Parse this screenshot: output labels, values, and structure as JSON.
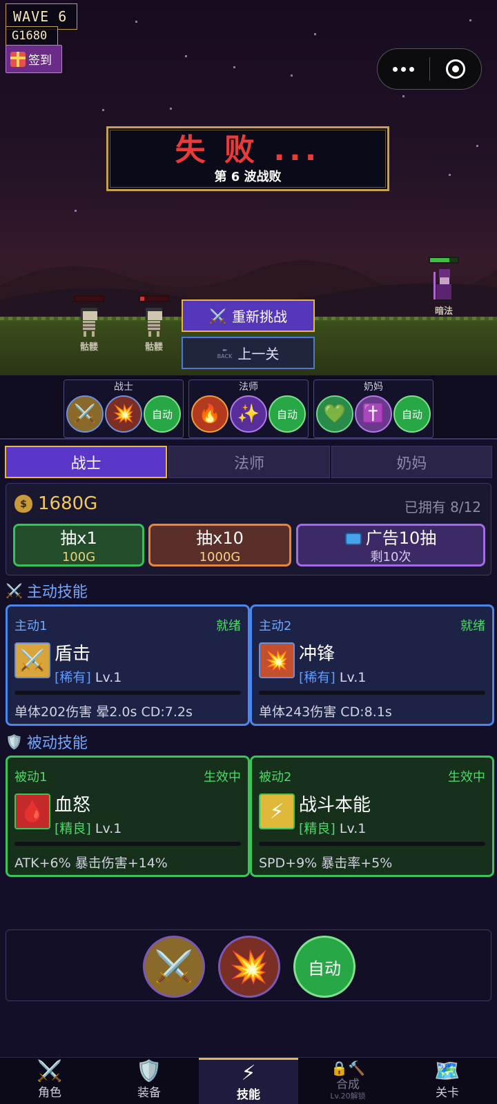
{
  "hud": {
    "wave": "WAVE  6",
    "gold": "G1680",
    "signin": "签到"
  },
  "result": {
    "title": "失 败 ...",
    "subtitle": "第 6 波战败",
    "retry": "重新挑战",
    "prev": "上一关",
    "prev_icon_text": "BACK"
  },
  "enemies": [
    {
      "name": "骷髅",
      "hp": 0.0
    },
    {
      "name": "骷髅",
      "hp": 0.15
    }
  ],
  "ally": {
    "name": "暗法",
    "hp": 0.7
  },
  "heroes": [
    {
      "name": "战士",
      "skills": [
        "swords-icon",
        "explosion-icon"
      ],
      "auto": "自动"
    },
    {
      "name": "法师",
      "skills": [
        "fire-icon",
        "sparkles-icon"
      ],
      "auto": "自动"
    },
    {
      "name": "奶妈",
      "skills": [
        "heart-icon",
        "cross-icon"
      ],
      "auto": "自动"
    }
  ],
  "tabs": [
    "战士",
    "法师",
    "奶妈"
  ],
  "gacha": {
    "gold": "1680G",
    "owned": "已拥有 8/12",
    "draw1": {
      "label": "抽x1",
      "cost": "100G"
    },
    "draw10": {
      "label": "抽x10",
      "cost": "1000G"
    },
    "ad": {
      "label": "广告10抽",
      "remain": "剩10次"
    }
  },
  "active_section": "主动技能",
  "passive_section": "被动技能",
  "active_skills": [
    {
      "slot": "主动1",
      "state": "就绪",
      "name": "盾击",
      "rarity": "[稀有]",
      "level": "Lv.1",
      "desc": "单体202伤害 晕2.0s CD:7.2s"
    },
    {
      "slot": "主动2",
      "state": "就绪",
      "name": "冲锋",
      "rarity": "[稀有]",
      "level": "Lv.1",
      "desc": "单体243伤害 CD:8.1s"
    }
  ],
  "passive_skills": [
    {
      "slot": "被动1",
      "state": "生效中",
      "name": "血怒",
      "rarity": "[精良]",
      "level": "Lv.1",
      "desc": "ATK+6% 暴击伤害+14%"
    },
    {
      "slot": "被动2",
      "state": "生效中",
      "name": "战斗本能",
      "rarity": "[精良]",
      "level": "Lv.1",
      "desc": "SPD+9% 暴击率+5%"
    }
  ],
  "quickbar": {
    "auto": "自动"
  },
  "nav": [
    {
      "label": "角色",
      "icon": "swords-icon"
    },
    {
      "label": "装备",
      "icon": "shield-icon"
    },
    {
      "label": "技能",
      "icon": "lightning-icon"
    },
    {
      "label": "合成",
      "icon": "lock-hammer-icon",
      "sub": "Lv.20解锁"
    },
    {
      "label": "关卡",
      "icon": "map-icon"
    }
  ],
  "colors": {
    "accent": "#e8b73c",
    "tab_active": "#5a37c8",
    "defeat": "#ea3a3a",
    "active_border": "#4c86ea",
    "passive_border": "#3bc45a"
  }
}
